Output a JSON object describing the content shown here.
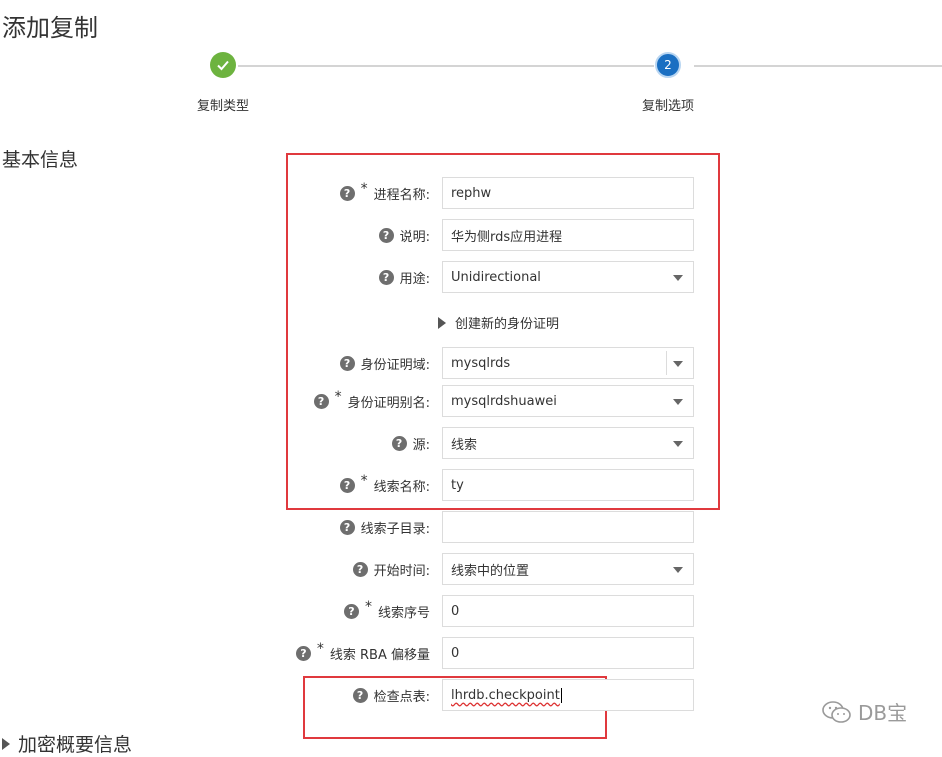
{
  "page": {
    "title": "添加复制"
  },
  "steps": [
    {
      "number": "✓",
      "label": "复制类型",
      "status": "done"
    },
    {
      "number": "2",
      "label": "复制选项",
      "status": "current"
    }
  ],
  "section": {
    "title": "基本信息"
  },
  "form": {
    "process_name": {
      "label": "进程名称:",
      "value": "rephw",
      "required": true
    },
    "description": {
      "label": "说明:",
      "value": "华为侧rds应用进程"
    },
    "usage": {
      "label": "用途:",
      "value": "Unidirectional"
    },
    "create_credential": {
      "label": "创建新的身份证明"
    },
    "credential_domain": {
      "label": "身份证明域:",
      "value": "mysqlrds"
    },
    "credential_alias": {
      "label": "身份证明别名:",
      "value": "mysqlrdshuawei",
      "required": true
    },
    "source": {
      "label": "源:",
      "value": "线索"
    },
    "trail_name": {
      "label": "线索名称:",
      "value": "ty",
      "required": true
    },
    "trail_subdir": {
      "label": "线索子目录:",
      "value": ""
    },
    "start_time": {
      "label": "开始时间:",
      "value": "线索中的位置"
    },
    "trail_seq": {
      "label": "线索序号",
      "value": "0",
      "required": true
    },
    "trail_rba": {
      "label": "线索 RBA 偏移量",
      "value": "0",
      "required": true
    },
    "checkpoint_table": {
      "label": "检查点表:",
      "value": "lhrdb.checkpoint"
    }
  },
  "encrypt_section": {
    "label": "加密概要信息"
  },
  "watermark": {
    "text": "DB宝"
  },
  "colors": {
    "done": "#6db33f",
    "current": "#1a6fc2",
    "highlight": "#e0393e"
  }
}
